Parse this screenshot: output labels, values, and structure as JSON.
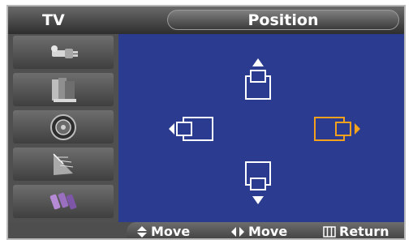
{
  "header": {
    "tv_label": "TV",
    "title": "Position"
  },
  "sidebar": {
    "items": [
      {
        "icon": "input-plug-icon"
      },
      {
        "icon": "picture-panels-icon"
      },
      {
        "icon": "sound-speaker-icon"
      },
      {
        "icon": "channel-antenna-icon"
      },
      {
        "icon": "setup-connectors-icon"
      }
    ]
  },
  "position_controls": {
    "up": "move-up-icon",
    "down": "move-down-icon",
    "left": "move-left-icon",
    "right": "move-right-icon",
    "selected": "right"
  },
  "footer": {
    "move_vertical_label": "Move",
    "move_horizontal_label": "Move",
    "return_label": "Return"
  },
  "colors": {
    "background": "#2b3b8f",
    "sidebar": "#505050",
    "icon_normal": "#ffffff",
    "icon_selected": "#f4a11d"
  }
}
